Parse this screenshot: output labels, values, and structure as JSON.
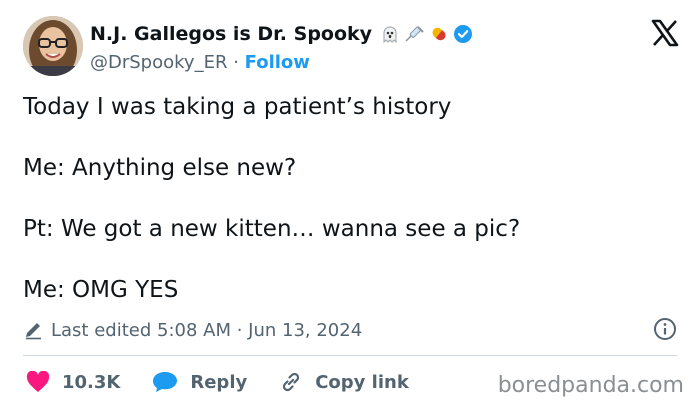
{
  "author": {
    "display_name": "N.J. Gallegos is Dr. Spooky",
    "handle": "@DrSpooky_ER",
    "separator": "·",
    "follow_label": "Follow"
  },
  "tweet": {
    "lines": [
      "Today I was taking a patient’s history",
      "Me: Anything else new?",
      "Pt: We got a new kitten… wanna see a pic?",
      "Me: OMG YES"
    ],
    "edited_label": "Last edited 5:08 AM · Jun 13, 2024"
  },
  "actions": {
    "likes": "10.3K",
    "reply_label": "Reply",
    "copy_link_label": "Copy link"
  },
  "watermark": "boredpanda.com",
  "colors": {
    "accent": "#1d9bf0",
    "like": "#f91880",
    "muted": "#536471"
  }
}
